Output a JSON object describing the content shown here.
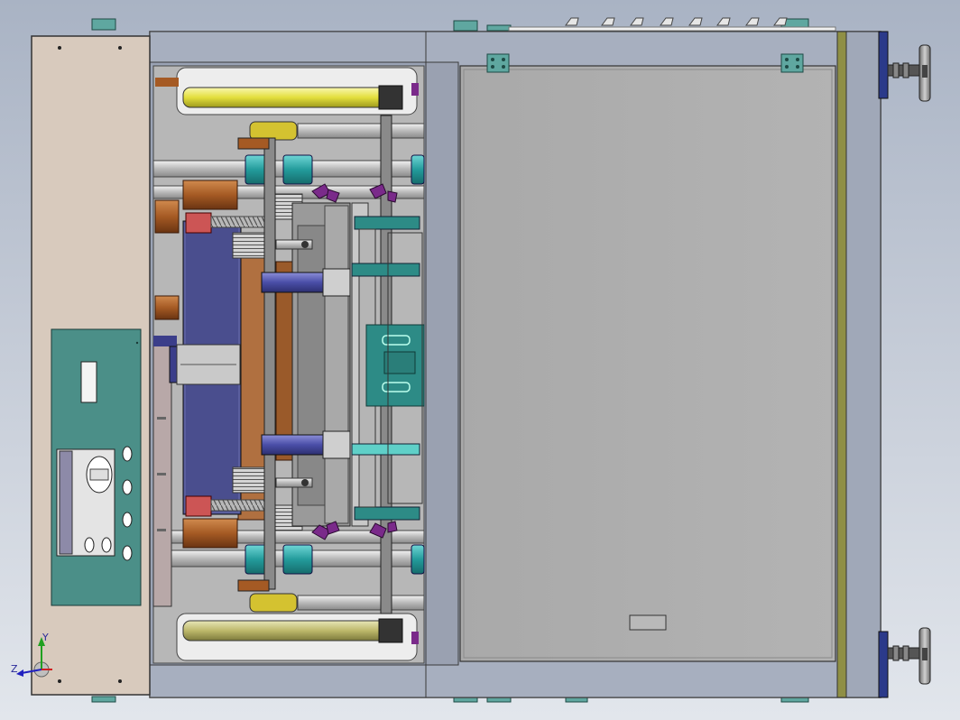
{
  "view": {
    "kind": "CAD assembly top view",
    "colors": {
      "background_top": "#a9b3c4",
      "background_bottom": "#e2e6ec",
      "control_cabinet": "#d8cabd",
      "control_panel": "#4b8f88",
      "housing_frame": "#a0a8b8",
      "right_door": "#ababab",
      "heater_tube": "#e6e24a",
      "guide_rod": "#c9c9c9",
      "cyan_bushing": "#2aa6a6",
      "copper_block": "#a55a24",
      "blue_plate": "#4a4e8e",
      "teal_bracket": "#2d8b86",
      "purple_clamp": "#7a2a8a",
      "hinge_teal": "#5fa7a0",
      "foot_navy": "#2b3a8a"
    }
  },
  "triad": {
    "x_axis_label": "",
    "y_axis_label": "Y",
    "z_axis_label": "Z",
    "x_axis_color": "#d02020",
    "y_axis_color": "#20a020",
    "z_axis_color": "#2020c0"
  }
}
